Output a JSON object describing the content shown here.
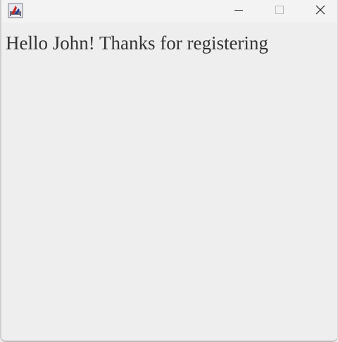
{
  "window": {
    "message": "Hello John! Thanks for registering"
  },
  "titlebar": {
    "icon": "java-app-icon",
    "controls": [
      "minimize-icon",
      "maximize-icon",
      "close-icon"
    ]
  },
  "colors": {
    "background": "#eeeeee",
    "titlebar": "#f3f3f3",
    "text": "#333333"
  }
}
